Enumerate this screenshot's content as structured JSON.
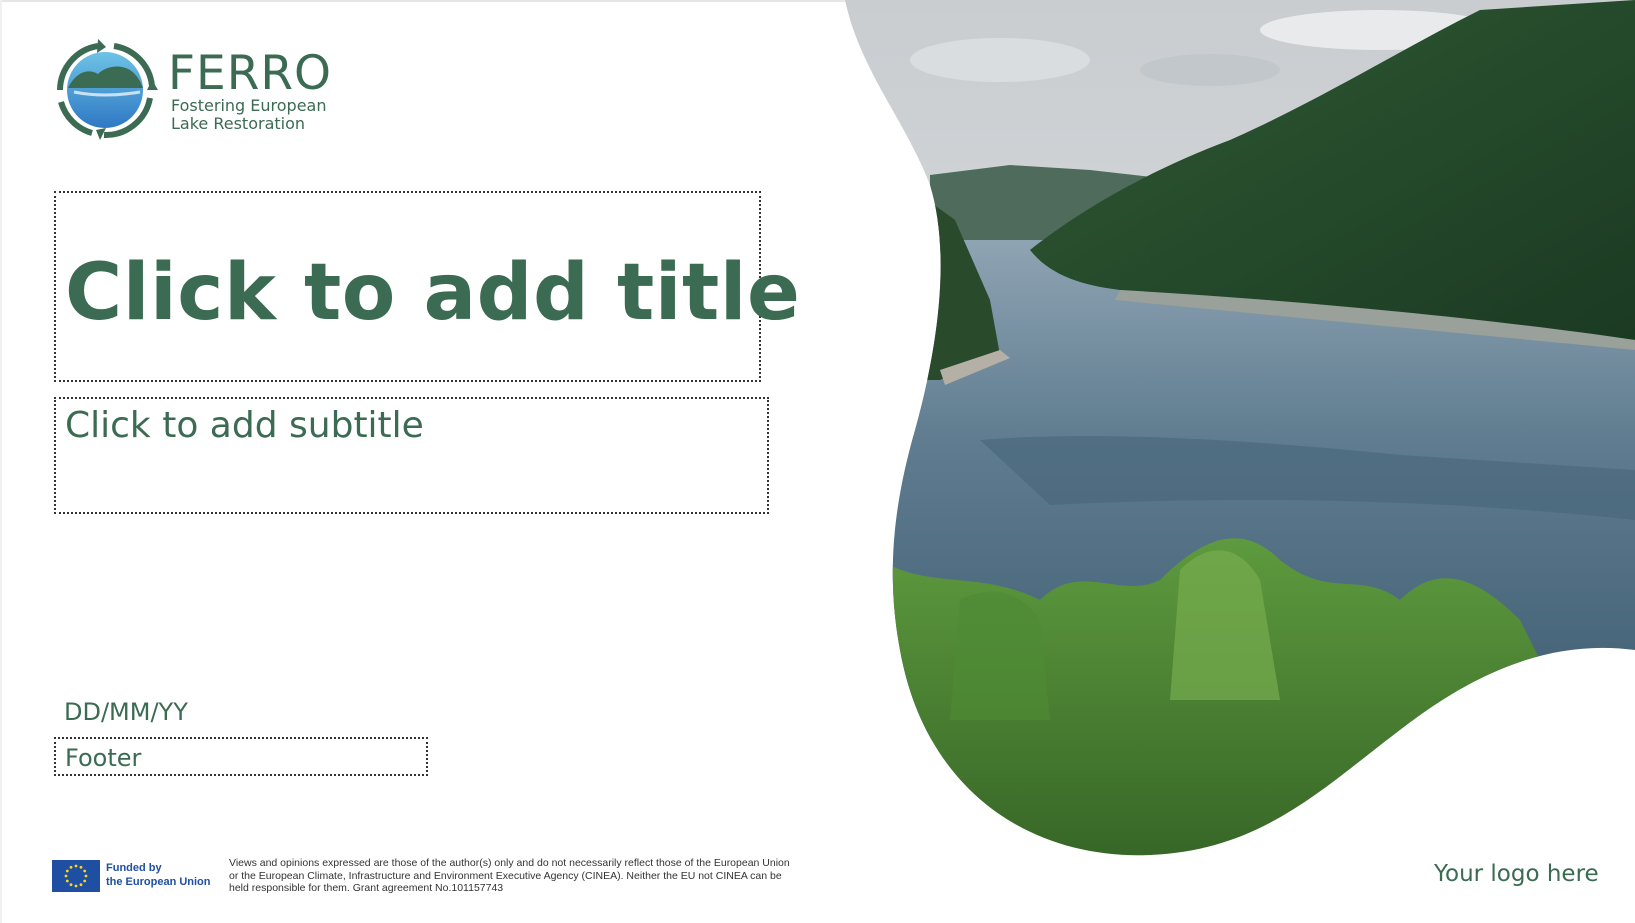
{
  "logo": {
    "name": "FERRO",
    "tagline_line1": "Fostering European",
    "tagline_line2": "Lake Restoration"
  },
  "slide": {
    "title_placeholder": "Click to add title",
    "subtitle_placeholder": "Click to add subtitle",
    "date_placeholder": "DD/MM/YY",
    "footer_placeholder": "Footer",
    "logo_placeholder": "Your logo here"
  },
  "funding": {
    "line1": "Funded by",
    "line2": "the European Union",
    "disclaimer_line1": "Views and opinions expressed are those of the author(s) only and do not necessarily reflect those of the European Union",
    "disclaimer_line2": "or the European Climate, Infrastructure and Environment Executive Agency (CINEA). Neither the EU not CINEA can be",
    "disclaimer_line3": "held responsible for them. Grant agreement No.101157743"
  },
  "colors": {
    "brand_green": "#3b6b52",
    "eu_blue": "#1f4fa3",
    "eu_star": "#ffd617"
  },
  "icons": {
    "ferro_logo": "circular-arrows-lake-emblem",
    "eu_flag": "eu-flag-icon"
  }
}
